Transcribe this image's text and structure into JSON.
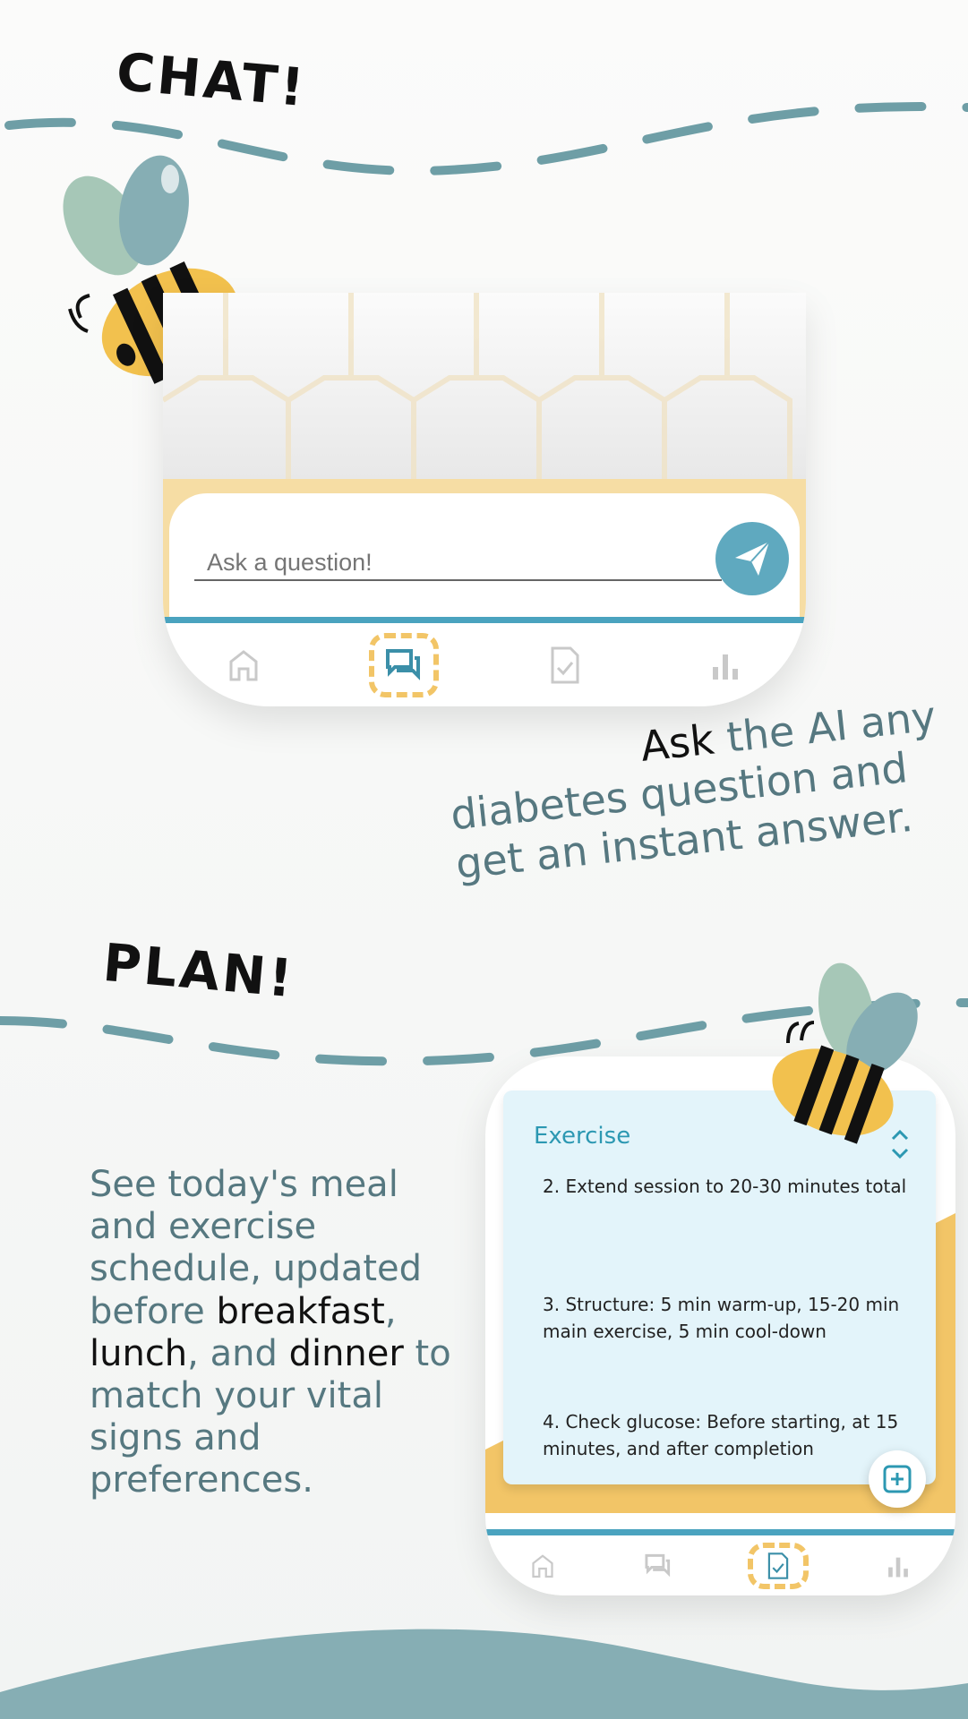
{
  "chat_section": {
    "heading": "CHAT!",
    "input_placeholder": "Ask a question!",
    "caption_highlight": "Ask",
    "caption_rest_line1": " the AI any",
    "caption_line2": "diabetes question and",
    "caption_line3": "get an instant answer."
  },
  "plan_section": {
    "heading": "PLAN!",
    "caption": {
      "l1": "See today's meal",
      "l2": "and exercise",
      "l3": "schedule, updated",
      "l4a": "before ",
      "l4b": "breakfast",
      "l4c": ",",
      "l5a": "lunch",
      "l5b": ", and ",
      "l5c": "dinner",
      "l5d": " to",
      "l6": "match your vital",
      "l7": "signs and",
      "l8": "preferences."
    },
    "panel": {
      "title": "Exercise",
      "items": [
        "2. Extend session to 20-30 minutes total",
        "3. Structure: 5 min warm-up, 15-20 min main exercise, 5 min cool-down",
        "4. Check glucose: Before starting, at 15 minutes, and after completion"
      ]
    }
  },
  "nav_icons": [
    "home-icon",
    "chat-icon",
    "checklist-icon",
    "stats-icon"
  ],
  "colors": {
    "accent_teal": "#4aa3bf",
    "highlight_yellow": "#f2c567",
    "caption_teal": "#567880",
    "panel_bg": "#e3f4fa",
    "bottom_wave": "#86aeb4"
  }
}
